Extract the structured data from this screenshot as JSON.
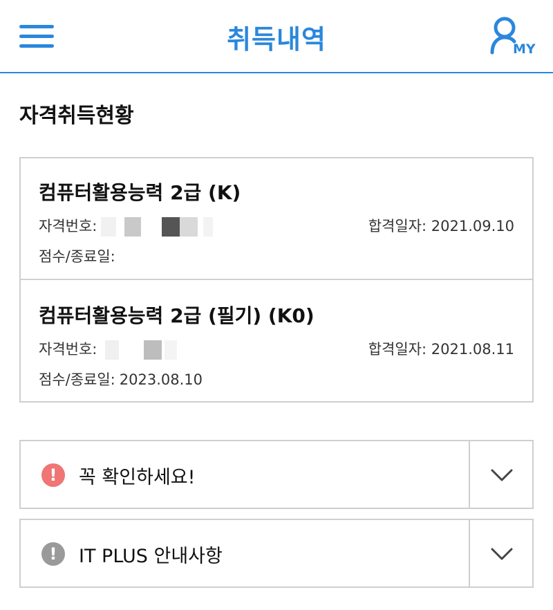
{
  "header": {
    "title": "취득내역",
    "my_label": "MY",
    "accent_color": "#2a87dc"
  },
  "section": {
    "title": "자격취득현황"
  },
  "certificates": [
    {
      "name": "컴퓨터활용능력 2급 (K)",
      "number_label": "자격번호:",
      "pass_date_label": "합격일자:",
      "pass_date": "2021.09.10",
      "score_label": "점수/종료일:",
      "score_value": ""
    },
    {
      "name": "컴퓨터활용능력 2급 (필기) (K0)",
      "number_label": "자격번호:",
      "pass_date_label": "합격일자:",
      "pass_date": "2021.08.11",
      "score_label": "점수/종료일:",
      "score_value": "2023.08.10"
    }
  ],
  "accordions": [
    {
      "label": "꼭 확인하세요!",
      "icon": "exclamation-circle-icon",
      "icon_color": "#f07575"
    },
    {
      "label": "IT PLUS 안내사항",
      "icon": "exclamation-circle-icon",
      "icon_color": "#9a9a9a"
    }
  ]
}
